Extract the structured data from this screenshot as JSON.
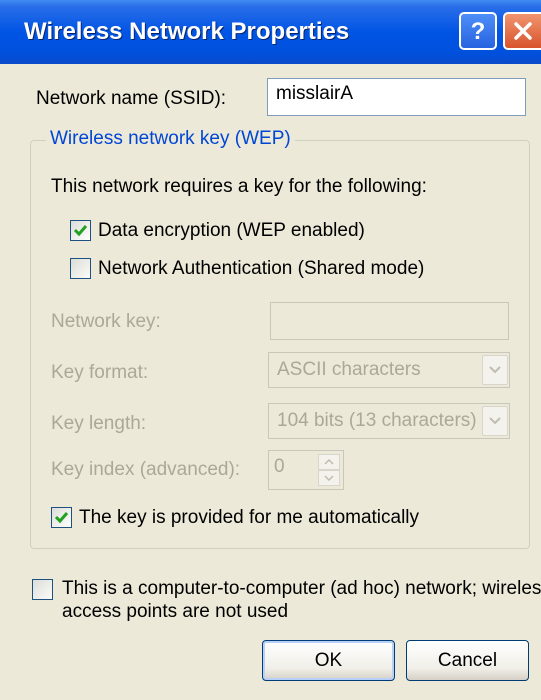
{
  "window": {
    "title": "Wireless Network Properties",
    "help_icon": "help-icon",
    "close_icon": "close-icon"
  },
  "ssid": {
    "label": "Network name (SSID):",
    "value": "misslairA"
  },
  "wep_group": {
    "title": "Wireless network key (WEP)",
    "requires_text": "This network requires a key for the following:",
    "data_encryption": {
      "label": "Data encryption (WEP enabled)",
      "checked": true
    },
    "network_auth": {
      "label": "Network Authentication (Shared mode)",
      "checked": false
    },
    "network_key": {
      "label": "Network key:",
      "value": ""
    },
    "key_format": {
      "label": "Key format:",
      "value": "ASCII characters"
    },
    "key_length": {
      "label": "Key length:",
      "value": "104 bits (13 characters)"
    },
    "key_index": {
      "label": "Key index (advanced):",
      "value": "0"
    },
    "auto_key": {
      "label": "The key is provided for me automatically",
      "checked": true
    }
  },
  "adhoc": {
    "label_line1": "This is a computer-to-computer (ad hoc) network; wireless",
    "label_line2": "access points are not used",
    "checked": false
  },
  "buttons": {
    "ok": "OK",
    "cancel": "Cancel"
  },
  "colors": {
    "titlebar": "#0055e5",
    "dialog_bg": "#ece9d8",
    "group_title": "#0046d5",
    "disabled_text": "#aca899",
    "checkmark": "#21a121"
  }
}
